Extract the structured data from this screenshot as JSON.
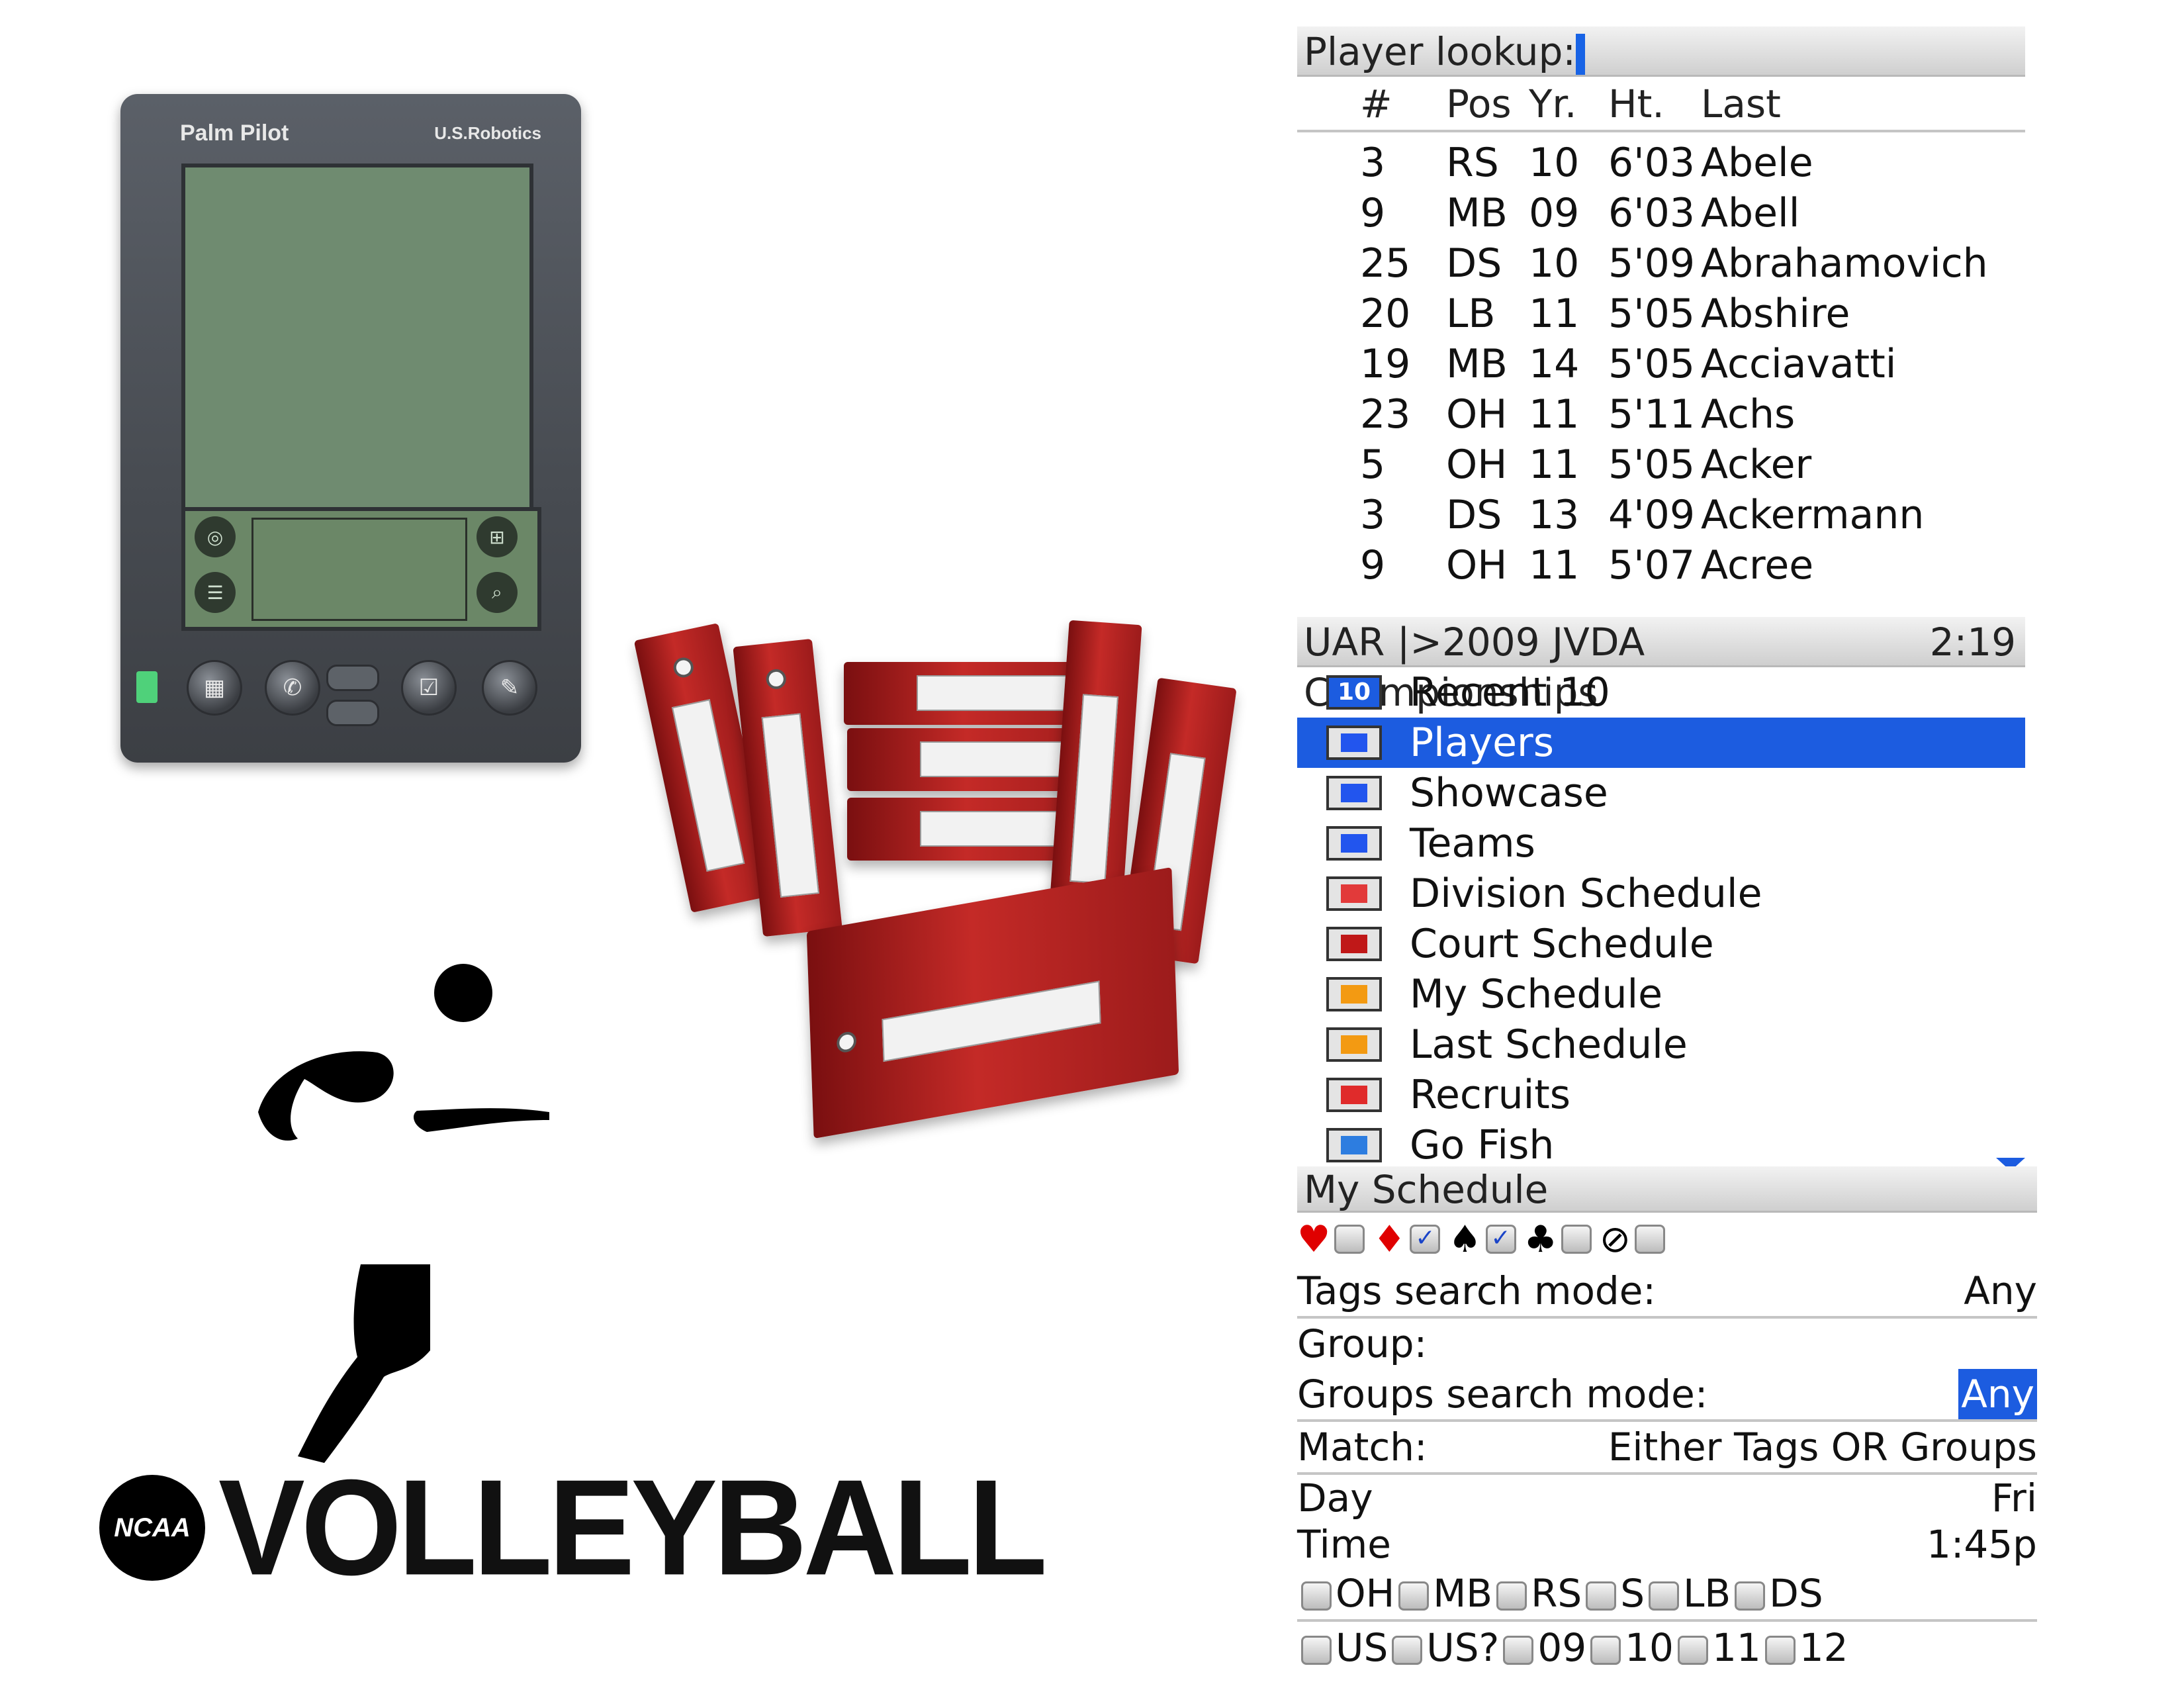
{
  "palm": {
    "brand": "Palm Pilot",
    "maker": "U.S.Robotics",
    "graffiti_icons": [
      "applications-icon",
      "calculator-icon",
      "menu-icon",
      "find-icon"
    ],
    "hardware_buttons": [
      "date-book-icon",
      "address-icon",
      "todo-icon",
      "memo-icon"
    ]
  },
  "logo": {
    "ncaa": "NCAA",
    "word": "VOLLEYBALL"
  },
  "lookup": {
    "title": "Player lookup:",
    "headers": {
      "num": "#",
      "pos": "Pos",
      "yr": "Yr.",
      "ht": "Ht.",
      "last": "Last"
    },
    "rows": [
      {
        "num": "3",
        "pos": "RS",
        "yr": "10",
        "ht": "6'03",
        "last": "Abele"
      },
      {
        "num": "9",
        "pos": "MB",
        "yr": "09",
        "ht": "6'03",
        "last": "Abell"
      },
      {
        "num": "25",
        "pos": "DS",
        "yr": "10",
        "ht": "5'09",
        "last": "Abrahamovich"
      },
      {
        "num": "20",
        "pos": "LB",
        "yr": "11",
        "ht": "5'05",
        "last": "Abshire"
      },
      {
        "num": "19",
        "pos": "MB",
        "yr": "14",
        "ht": "5'05",
        "last": "Acciavatti"
      },
      {
        "num": "23",
        "pos": "OH",
        "yr": "11",
        "ht": "5'11",
        "last": "Achs"
      },
      {
        "num": "5",
        "pos": "OH",
        "yr": "11",
        "ht": "5'05",
        "last": "Acker"
      },
      {
        "num": "3",
        "pos": "DS",
        "yr": "13",
        "ht": "4'09",
        "last": "Ackermann"
      },
      {
        "num": "9",
        "pos": "OH",
        "yr": "11",
        "ht": "5'07",
        "last": "Acree"
      }
    ]
  },
  "menu": {
    "title": "UAR |>2009 JVDA Championships",
    "time": "2:19",
    "items": [
      {
        "label": "Recent 10",
        "icon": "recent-10-icon",
        "glyph": "10",
        "color": "#1c5ce0"
      },
      {
        "label": "Players",
        "icon": "players-icon",
        "glyph": "",
        "color": "#2255ee",
        "selected": true
      },
      {
        "label": "Showcase",
        "icon": "showcase-icon",
        "glyph": "",
        "color": "#2255ee"
      },
      {
        "label": "Teams",
        "icon": "teams-icon",
        "glyph": "",
        "color": "#2255ee"
      },
      {
        "label": "Division Schedule",
        "icon": "division-schedule-icon",
        "glyph": "",
        "color": "#e23a3a"
      },
      {
        "label": "Court Schedule",
        "icon": "court-schedule-icon",
        "glyph": "",
        "color": "#c01818"
      },
      {
        "label": "My Schedule",
        "icon": "my-schedule-icon",
        "glyph": "",
        "color": "#f39a12"
      },
      {
        "label": "Last Schedule",
        "icon": "last-schedule-icon",
        "glyph": "",
        "color": "#f39a12"
      },
      {
        "label": "Recruits",
        "icon": "recruits-icon",
        "glyph": "",
        "color": "#e02b2b"
      },
      {
        "label": "Go Fish",
        "icon": "go-fish-icon",
        "glyph": "",
        "color": "#2d7de0"
      }
    ]
  },
  "schedule": {
    "title": "My Schedule",
    "tag_filters": [
      {
        "icon": "heart-icon",
        "glyph": "♥",
        "color": "#e00000",
        "checked": false
      },
      {
        "icon": "diamond-icon",
        "glyph": "♦",
        "color": "#e00000",
        "checked": true
      },
      {
        "icon": "spade-icon",
        "glyph": "♠",
        "color": "#000000",
        "checked": true
      },
      {
        "icon": "club-icon",
        "glyph": "♣",
        "color": "#000000",
        "checked": false
      },
      {
        "icon": "none-icon",
        "glyph": "⊘",
        "color": "#000000",
        "checked": false
      }
    ],
    "tags_mode_label": "Tags search mode:",
    "tags_mode_value": "Any",
    "group_label": "Group:",
    "groups_mode_label": "Groups search mode:",
    "groups_mode_value": "Any",
    "match_label": "Match:",
    "match_value": "Either Tags OR Groups",
    "day_label": "Day",
    "day_value": "Fri",
    "time_label": "Time",
    "time_value": "1:45p",
    "positions": [
      "OH",
      "MB",
      "RS",
      "S",
      "LB",
      "DS"
    ],
    "years": [
      "US",
      "US?",
      "09",
      "10",
      "11",
      "12"
    ]
  }
}
